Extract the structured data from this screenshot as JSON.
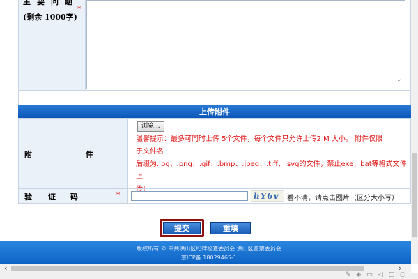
{
  "problem": {
    "label_line1": "主要问题",
    "label_line2": "(剩余 1000字)",
    "required_mark": "*",
    "textarea_value": ""
  },
  "attachments": {
    "section_title": "上传附件",
    "label_left": "附",
    "label_right": "件",
    "browse_label": "浏览...",
    "tip_line1": "温馨提示：最多可同时上传 5个文件，每个文件只允许上传2 M 大小。 附件仅限",
    "tip_line2": "于文件名",
    "tip_line3": "后缀为.jpg、.png、.gif、.bmp、.jpeg、.tiff、.svg的文件，禁止exe、bat等格式文件上",
    "tip_line4": "传!"
  },
  "captcha": {
    "label_a": "验",
    "label_b": "证",
    "label_c": "码",
    "required_mark": "*",
    "input_value": "",
    "image_text": "hY6v",
    "hint": "看不清，请点击图片（区分大小写）"
  },
  "buttons": {
    "submit": "提交",
    "reset": "重填"
  },
  "footer": {
    "line1": "版权所有 © 中共洪山区纪律检查委员会 洪山区监察委员会",
    "line2": "京ICP备 18029465-1"
  },
  "colors": {
    "header_blue": "#0a57b8",
    "required_red": "#e02020",
    "tip_red": "#e01010",
    "submit_focus_border": "#8e1010"
  }
}
